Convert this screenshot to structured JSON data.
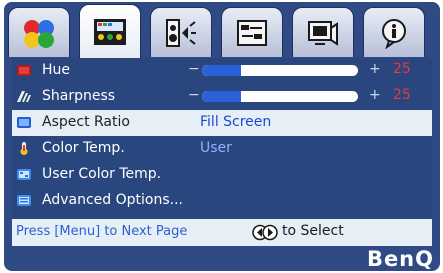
{
  "tabs": [
    {
      "icon": "color-picture-icon",
      "active": false
    },
    {
      "icon": "display-settings-icon",
      "active": true
    },
    {
      "icon": "audio-settings-icon",
      "active": false
    },
    {
      "icon": "system-setup-icon",
      "active": false
    },
    {
      "icon": "input-source-icon",
      "active": false
    },
    {
      "icon": "information-icon",
      "active": false
    }
  ],
  "menu": {
    "hue": {
      "label": "Hue",
      "minus": "−",
      "plus": "+",
      "value": "25",
      "level": 0.25
    },
    "sharpness": {
      "label": "Sharpness",
      "minus": "−",
      "plus": "+",
      "value": "25",
      "level": 0.25
    },
    "aspect_ratio": {
      "label": "Aspect Ratio",
      "value": "Fill Screen"
    },
    "color_temp": {
      "label": "Color Temp.",
      "value": "User"
    },
    "user_color_temp": {
      "label": "User Color Temp."
    },
    "advanced_options": {
      "label": "Advanced Options..."
    }
  },
  "footer": {
    "left_hint": "Press [Menu] to Next Page",
    "right_hint": "to Select"
  },
  "brand": "BenQ",
  "colors": {
    "background": "#2f4a85",
    "selected_row": "#e6eff6",
    "value_text": "#8fb4ff",
    "number_text": "#e83a3a",
    "slider_fill": "#2b61d6"
  }
}
